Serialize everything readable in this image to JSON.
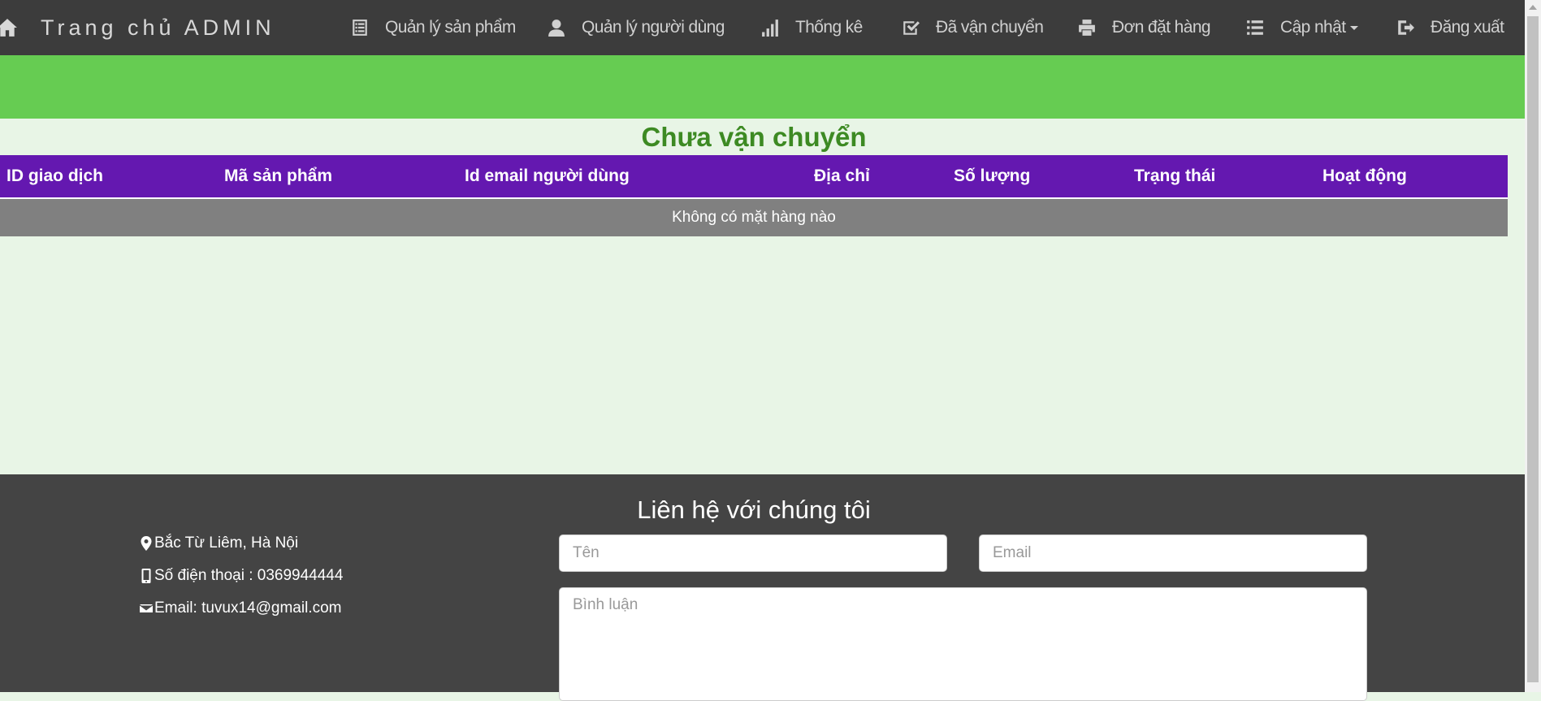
{
  "navbar": {
    "brand": "Trang chủ ADMIN",
    "items": [
      {
        "label": "Quản lý sản phẩm",
        "icon": "list-alt-icon"
      },
      {
        "label": "Quản lý người dùng",
        "icon": "user-icon"
      },
      {
        "label": "Thống kê",
        "icon": "signal-icon"
      },
      {
        "label": "Đã vận chuyển",
        "icon": "check-icon"
      },
      {
        "label": "Đơn đặt hàng",
        "icon": "print-icon"
      },
      {
        "label": "Cập nhật",
        "icon": "list-icon"
      },
      {
        "label": "Đăng xuất",
        "icon": "log-out-icon"
      }
    ]
  },
  "main": {
    "title": "Chưa vận chuyển",
    "table": {
      "columns": [
        "ID giao dịch",
        "Mã sản phẩm",
        "Id email người dùng",
        "Địa chỉ",
        "Số lượng",
        "Trạng thái",
        "Hoạt động"
      ],
      "empty_message": "Không có mặt hàng nào"
    }
  },
  "footer": {
    "title": "Liên hệ với chúng tôi",
    "address": "Bắc Từ Liêm, Hà Nội",
    "phone": "Số điện thoại : 0369944444",
    "email": "Email: tuvux14@gmail.com",
    "form": {
      "name_placeholder": "Tên",
      "email_placeholder": "Email",
      "comment_placeholder": "Bình luận"
    }
  },
  "colors": {
    "navbar": "#3c3c3c",
    "green_band": "#66cc52",
    "page_background": "#e8f5e6",
    "title": "#3d8a23",
    "table_header": "#6418b0",
    "empty_row": "#808080",
    "footer": "#444444"
  }
}
